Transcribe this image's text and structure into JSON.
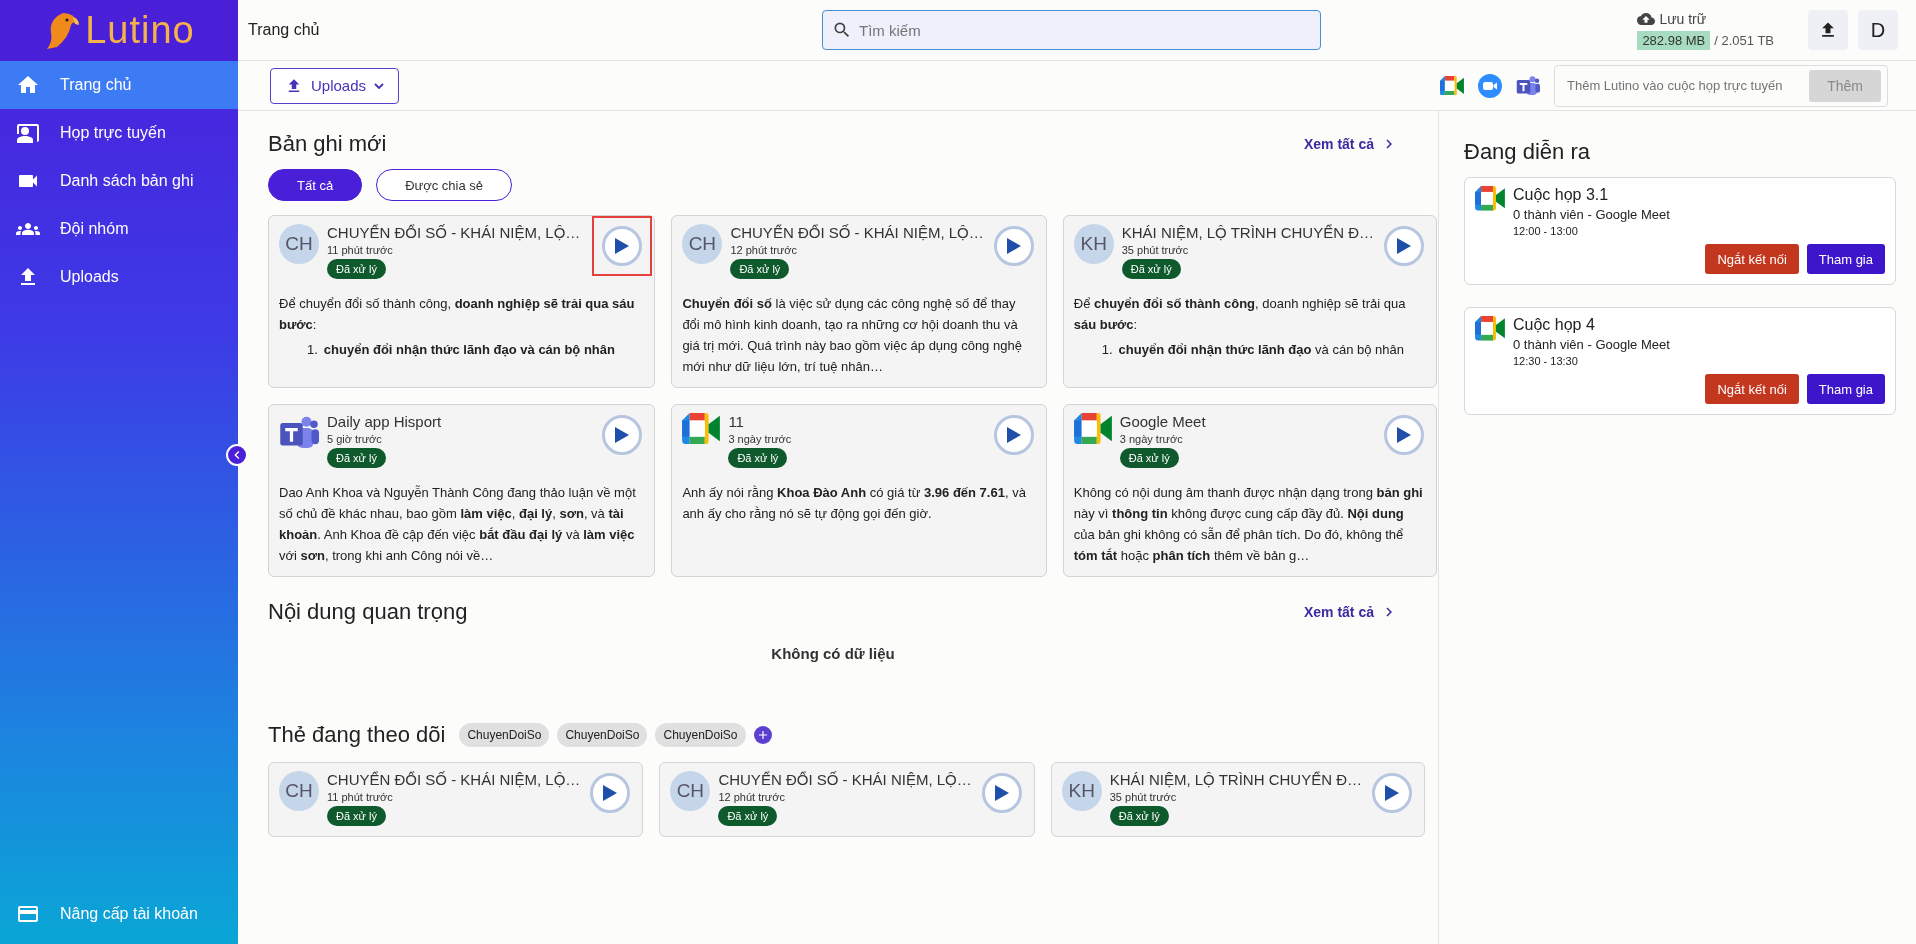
{
  "sidebar": {
    "logo": "Lutino",
    "items": [
      {
        "label": "Trang chủ",
        "kind": "home",
        "selected": true
      },
      {
        "label": "Họp trực tuyến",
        "kind": "meeting",
        "selected": false
      },
      {
        "label": "Danh sách bản ghi",
        "kind": "camera",
        "selected": false
      },
      {
        "label": "Đội nhóm",
        "kind": "team",
        "selected": false
      },
      {
        "label": "Uploads",
        "kind": "upload",
        "selected": false
      }
    ],
    "footer": "Nâng cấp tài khoản"
  },
  "header": {
    "breadcrumb": "Trang chủ",
    "search": {
      "placeholder": "Tìm kiếm"
    },
    "storage": {
      "label": "Lưu trữ",
      "used": "282.98 MB",
      "total": "/ 2.051 TB"
    },
    "avatar": "D"
  },
  "toolbar": {
    "uploads_button": "Uploads",
    "platforms": [
      {
        "kind": "meet"
      },
      {
        "kind": "zoom"
      },
      {
        "kind": "teams"
      }
    ],
    "invite": {
      "placeholder": "Thêm Lutino vào cuộc họp trực tuyến",
      "button": "Thêm",
      "disabled": true
    }
  },
  "recent": {
    "title": "Bản ghi mới",
    "view_all": "Xem tất cả",
    "filters": [
      {
        "label": "Tất cả",
        "selected": true
      },
      {
        "label": "Được chia sẻ",
        "selected": false
      }
    ],
    "cards": [
      {
        "avatar": {
          "kind": "initials",
          "text": "CH"
        },
        "title": "CHUYỂN ĐỔI SỐ - KHÁI NIỆM, LỘ…",
        "time": "11 phút trước",
        "status": "Đã xử lý",
        "highlighted": true,
        "summary": "Để chuyển đổi số thành công, **doanh nghiệp sẽ trải qua sáu bước**:",
        "list": [
          {
            "number": "1.",
            "text": "**chuyển đổi nhận thức lãnh đạo và cán bộ nhân**"
          }
        ]
      },
      {
        "avatar": {
          "kind": "initials",
          "text": "CH"
        },
        "title": "CHUYỂN ĐỔI SỐ - KHÁI NIỆM, LỘ…",
        "time": "12 phút trước",
        "status": "Đã xử lý",
        "highlighted": false,
        "summary": "**Chuyển đổi số** là việc sử dụng các công nghệ số để thay đổi mô hình kinh doanh, tạo ra những cơ hội doanh thu và giá trị mới. Quá trình này bao gồm việc áp dụng công nghệ mới như dữ liệu lớn, trí tuệ nhân…"
      },
      {
        "avatar": {
          "kind": "initials",
          "text": "KH"
        },
        "title": "KHÁI NIỆM, LỘ TRÌNH CHUYỂN Đ…",
        "time": "35 phút trước",
        "status": "Đã xử lý",
        "highlighted": false,
        "summary": "Để **chuyển đổi số thành công**, doanh nghiệp sẽ trải qua **sáu bước**:",
        "list": [
          {
            "number": "1.",
            "text": "**chuyển đổi nhận thức lãnh đạo** và cán bộ nhân"
          }
        ]
      },
      {
        "avatar": {
          "kind": "teams"
        },
        "title": "Daily app Hisport",
        "time": "5 giờ trước",
        "status": "Đã xử lý",
        "highlighted": false,
        "summary": "Dao Anh Khoa và Nguyễn Thành Công đang thảo luận về một số chủ đề khác nhau, bao gồm **làm việc**, **đại lý**, **sơn**, và **tài khoản**. Anh Khoa đề cập đến việc **bắt đầu đại lý** và **làm việc** với **sơn**, trong khi anh Công nói về…"
      },
      {
        "avatar": {
          "kind": "meet"
        },
        "title": "11",
        "time": "3 ngày trước",
        "status": "Đã xử lý",
        "highlighted": false,
        "summary": "Anh ấy nói rằng **Khoa Đào Anh** có giá từ **3.96 đến 7.61**, và anh ấy cho rằng nó sẽ tự động gọi đến giờ."
      },
      {
        "avatar": {
          "kind": "meet"
        },
        "title": "Google Meet",
        "time": "3 ngày trước",
        "status": "Đã xử lý",
        "highlighted": false,
        "summary": "Không có nội dung âm thanh được nhận dạng trong **bản ghi** này vì **thông tin** không được cung cấp đầy đủ. **Nội dung** của bản ghi không có sẵn để phân tích. Do đó, không thể **tóm tắt** hoặc **phân tích** thêm về bản g…"
      }
    ]
  },
  "important": {
    "title": "Nội dung quan trọng",
    "view_all": "Xem tất cả",
    "empty": "Không có dữ liệu"
  },
  "followed": {
    "title": "Thẻ đang theo dõi",
    "tags": [
      "ChuyenDoiSo",
      "ChuyenDoiSo",
      "ChuyenDoiSo"
    ],
    "cards": [
      {
        "avatar": {
          "kind": "initials",
          "text": "CH"
        },
        "title": "CHUYỂN ĐỔI SỐ - KHÁI NIỆM, LỘ…",
        "time": "11 phút trước",
        "status": "Đã xử lý",
        "highlighted": false
      },
      {
        "avatar": {
          "kind": "initials",
          "text": "CH"
        },
        "title": "CHUYỂN ĐỔI SỐ - KHÁI NIỆM, LỘ…",
        "time": "12 phút trước",
        "status": "Đã xử lý",
        "highlighted": false
      },
      {
        "avatar": {
          "kind": "initials",
          "text": "KH"
        },
        "title": "KHÁI NIỆM, LỘ TRÌNH CHUYỂN Đ…",
        "time": "35 phút trước",
        "status": "Đã xử lý",
        "highlighted": false
      }
    ]
  },
  "live": {
    "title": "Đang diễn ra",
    "meetings": [
      {
        "title": "Cuộc họp 3.1",
        "subtitle": "0 thành viên - Google Meet",
        "time": "12:00 - 13:00",
        "disconnect": "Ngắt kết nối",
        "join": "Tham gia"
      },
      {
        "title": "Cuộc họp 4",
        "subtitle": "0 thành viên - Google Meet",
        "time": "12:30 - 13:30",
        "disconnect": "Ngắt kết nối",
        "join": "Tham gia"
      }
    ]
  }
}
